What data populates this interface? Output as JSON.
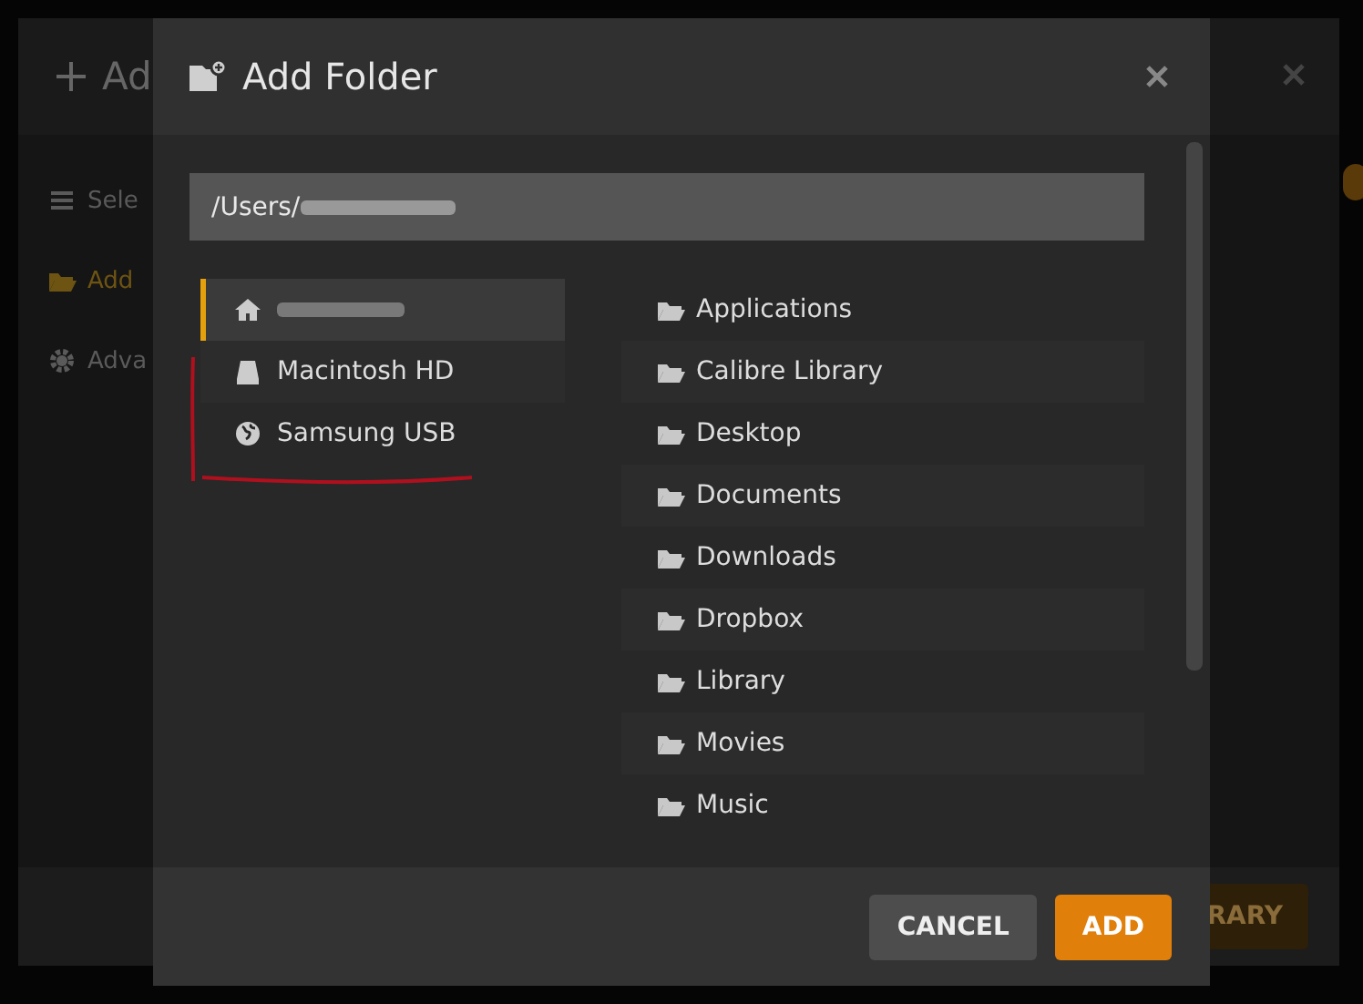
{
  "background_window": {
    "title": "Ad",
    "sidebar": [
      {
        "kind": "list",
        "label": "Sele",
        "selected": false
      },
      {
        "kind": "folder",
        "label": "Add",
        "selected": true
      },
      {
        "kind": "gear",
        "label": "Adva",
        "selected": false
      }
    ],
    "footer_button": "RARY"
  },
  "dialog": {
    "title": "Add Folder",
    "path": {
      "value": "/Users/"
    },
    "locations": [
      {
        "kind": "home",
        "selected": true
      },
      {
        "kind": "disk",
        "label": "Macintosh HD",
        "selected": false
      },
      {
        "kind": "globe",
        "label": "Samsung USB",
        "selected": false
      }
    ],
    "folders": [
      "Applications",
      "Calibre Library",
      "Desktop",
      "Documents",
      "Downloads",
      "Dropbox",
      "Library",
      "Movies",
      "Music"
    ],
    "buttons": [
      {
        "kind": "secondary",
        "label": "CANCEL"
      },
      {
        "kind": "primary",
        "label": "ADD"
      }
    ]
  }
}
